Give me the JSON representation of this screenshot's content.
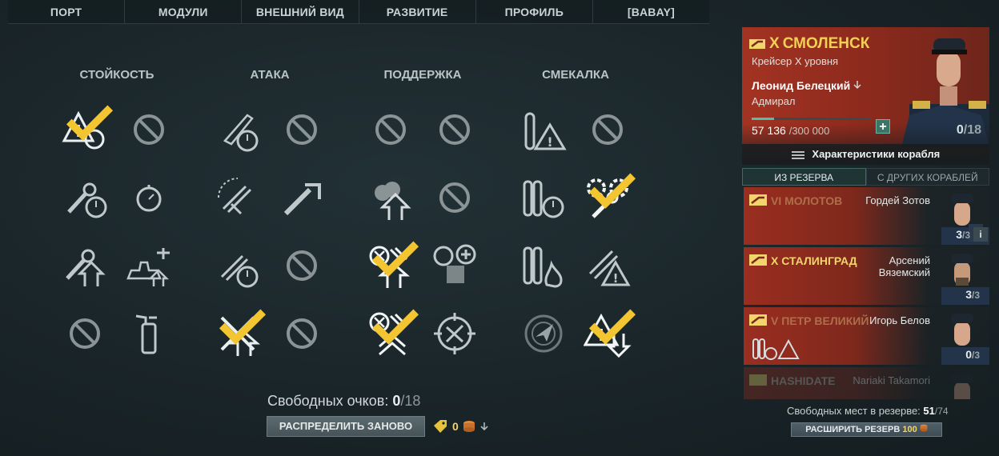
{
  "nav": {
    "tabs": [
      "ПОРТ",
      "МОДУЛИ",
      "ВНЕШНИЙ ВИД",
      "РАЗВИТИЕ",
      "ПРОФИЛЬ",
      "[BABAY]"
    ]
  },
  "skills": {
    "categories": [
      "СТОЙКОСТЬ",
      "АТАКА",
      "ПОДДЕРЖКА",
      "СМЕКАЛКА"
    ]
  },
  "footer": {
    "free_points_label": "Свободных очков:",
    "free_points": "0",
    "free_points_total": "/18",
    "redistribute_label": "РАСПРЕДЕЛИТЬ ЗАНОВО",
    "cost": "0"
  },
  "ship_card": {
    "tier": "X",
    "name": "СМОЛЕНСК",
    "subtitle": "Крейсер X уровня",
    "commander": "Леонид Белецкий",
    "rank": "Адмирал",
    "xp_current": "57 136",
    "xp_max": "/300 000",
    "xp_fraction": 0.19,
    "points": "0",
    "points_total": "/18",
    "characteristics_label": "Характеристики корабля"
  },
  "reserve_tabs": [
    "ИЗ РЕЗЕРВА",
    "С ДРУГИХ КОРАБЛЕЙ"
  ],
  "reserve": [
    {
      "tier": "VI",
      "ship": "МОЛОТОВ",
      "commander": "Гордей Зотов",
      "points": "3",
      "total": "/3"
    },
    {
      "tier": "X",
      "ship": "СТАЛИНГРАД",
      "commander": "Арсений Вяземский",
      "points": "3",
      "total": "/3"
    },
    {
      "tier": "V",
      "ship": "ПЕТР ВЕЛИКИЙ",
      "commander": "Игорь Белов",
      "points": "0",
      "total": "/3"
    },
    {
      "tier": "",
      "ship": "HASHIDATE",
      "commander": "Nariaki Takamori",
      "points": "",
      "total": ""
    }
  ],
  "reserve_footer": {
    "free_label": "Свободных мест в резерве:",
    "free": "51",
    "total": "/74",
    "expand_label": "РАСШИРИТЬ РЕЗЕРВ",
    "expand_cost": "100"
  },
  "colors": {
    "gold": "#f2d56b",
    "flag_red": "#9a2e20",
    "teal": "#4fc1a8"
  }
}
